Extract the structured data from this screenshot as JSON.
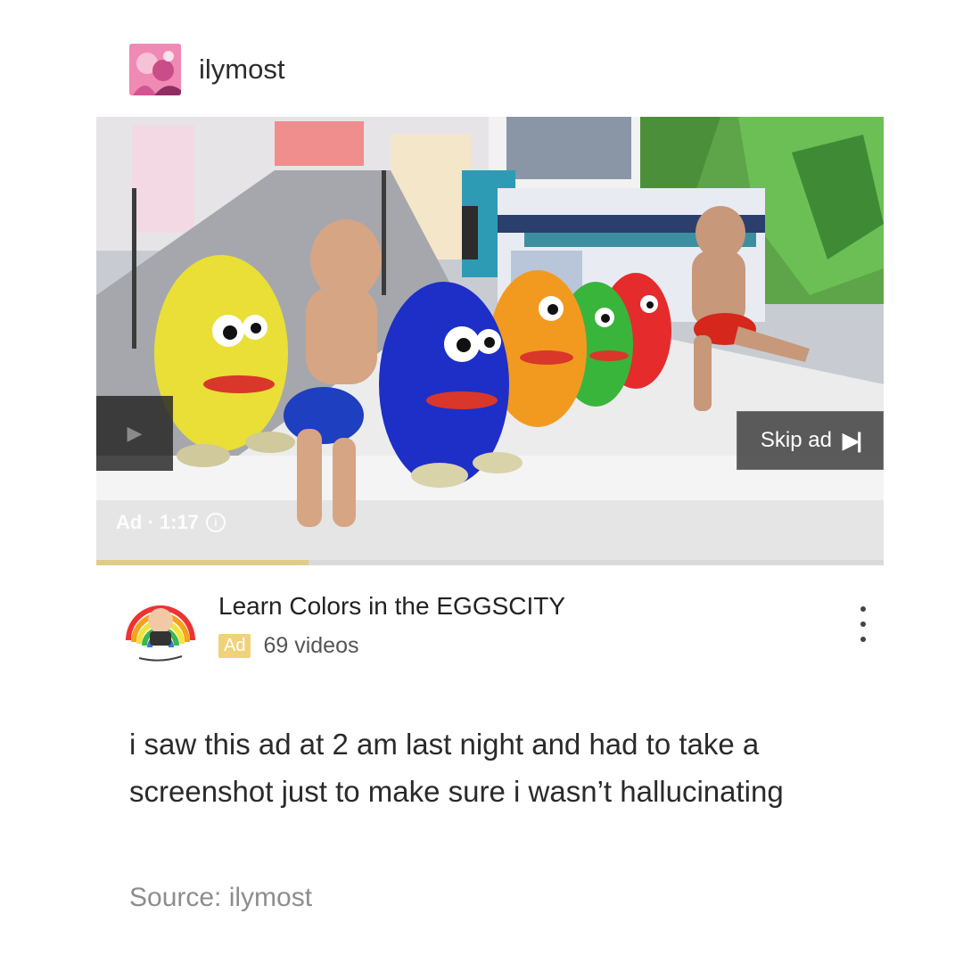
{
  "post": {
    "username": "ilymost",
    "avatar_icon": "user-avatar-icon"
  },
  "video": {
    "skip_label": "Skip ad",
    "skip_icon": "skip-next-icon",
    "ad_time": "Ad · 1:17",
    "info_icon": "info-icon",
    "prev_icon": "play-prev-icon",
    "progress": 0.27
  },
  "channel": {
    "title": "Learn Colors in the EGGSCITY",
    "badge": "Ad",
    "video_count": "69 videos",
    "more_icon": "more-vertical-icon"
  },
  "caption": "i saw this ad at 2 am last night and had to take a screenshot just to make sure i wasn’t hallucinating",
  "source": "Source: ilymost",
  "colors": {
    "ad_badge": "#f0d27a",
    "progress": "#e0cc8a",
    "skip_bg": "#464646"
  }
}
